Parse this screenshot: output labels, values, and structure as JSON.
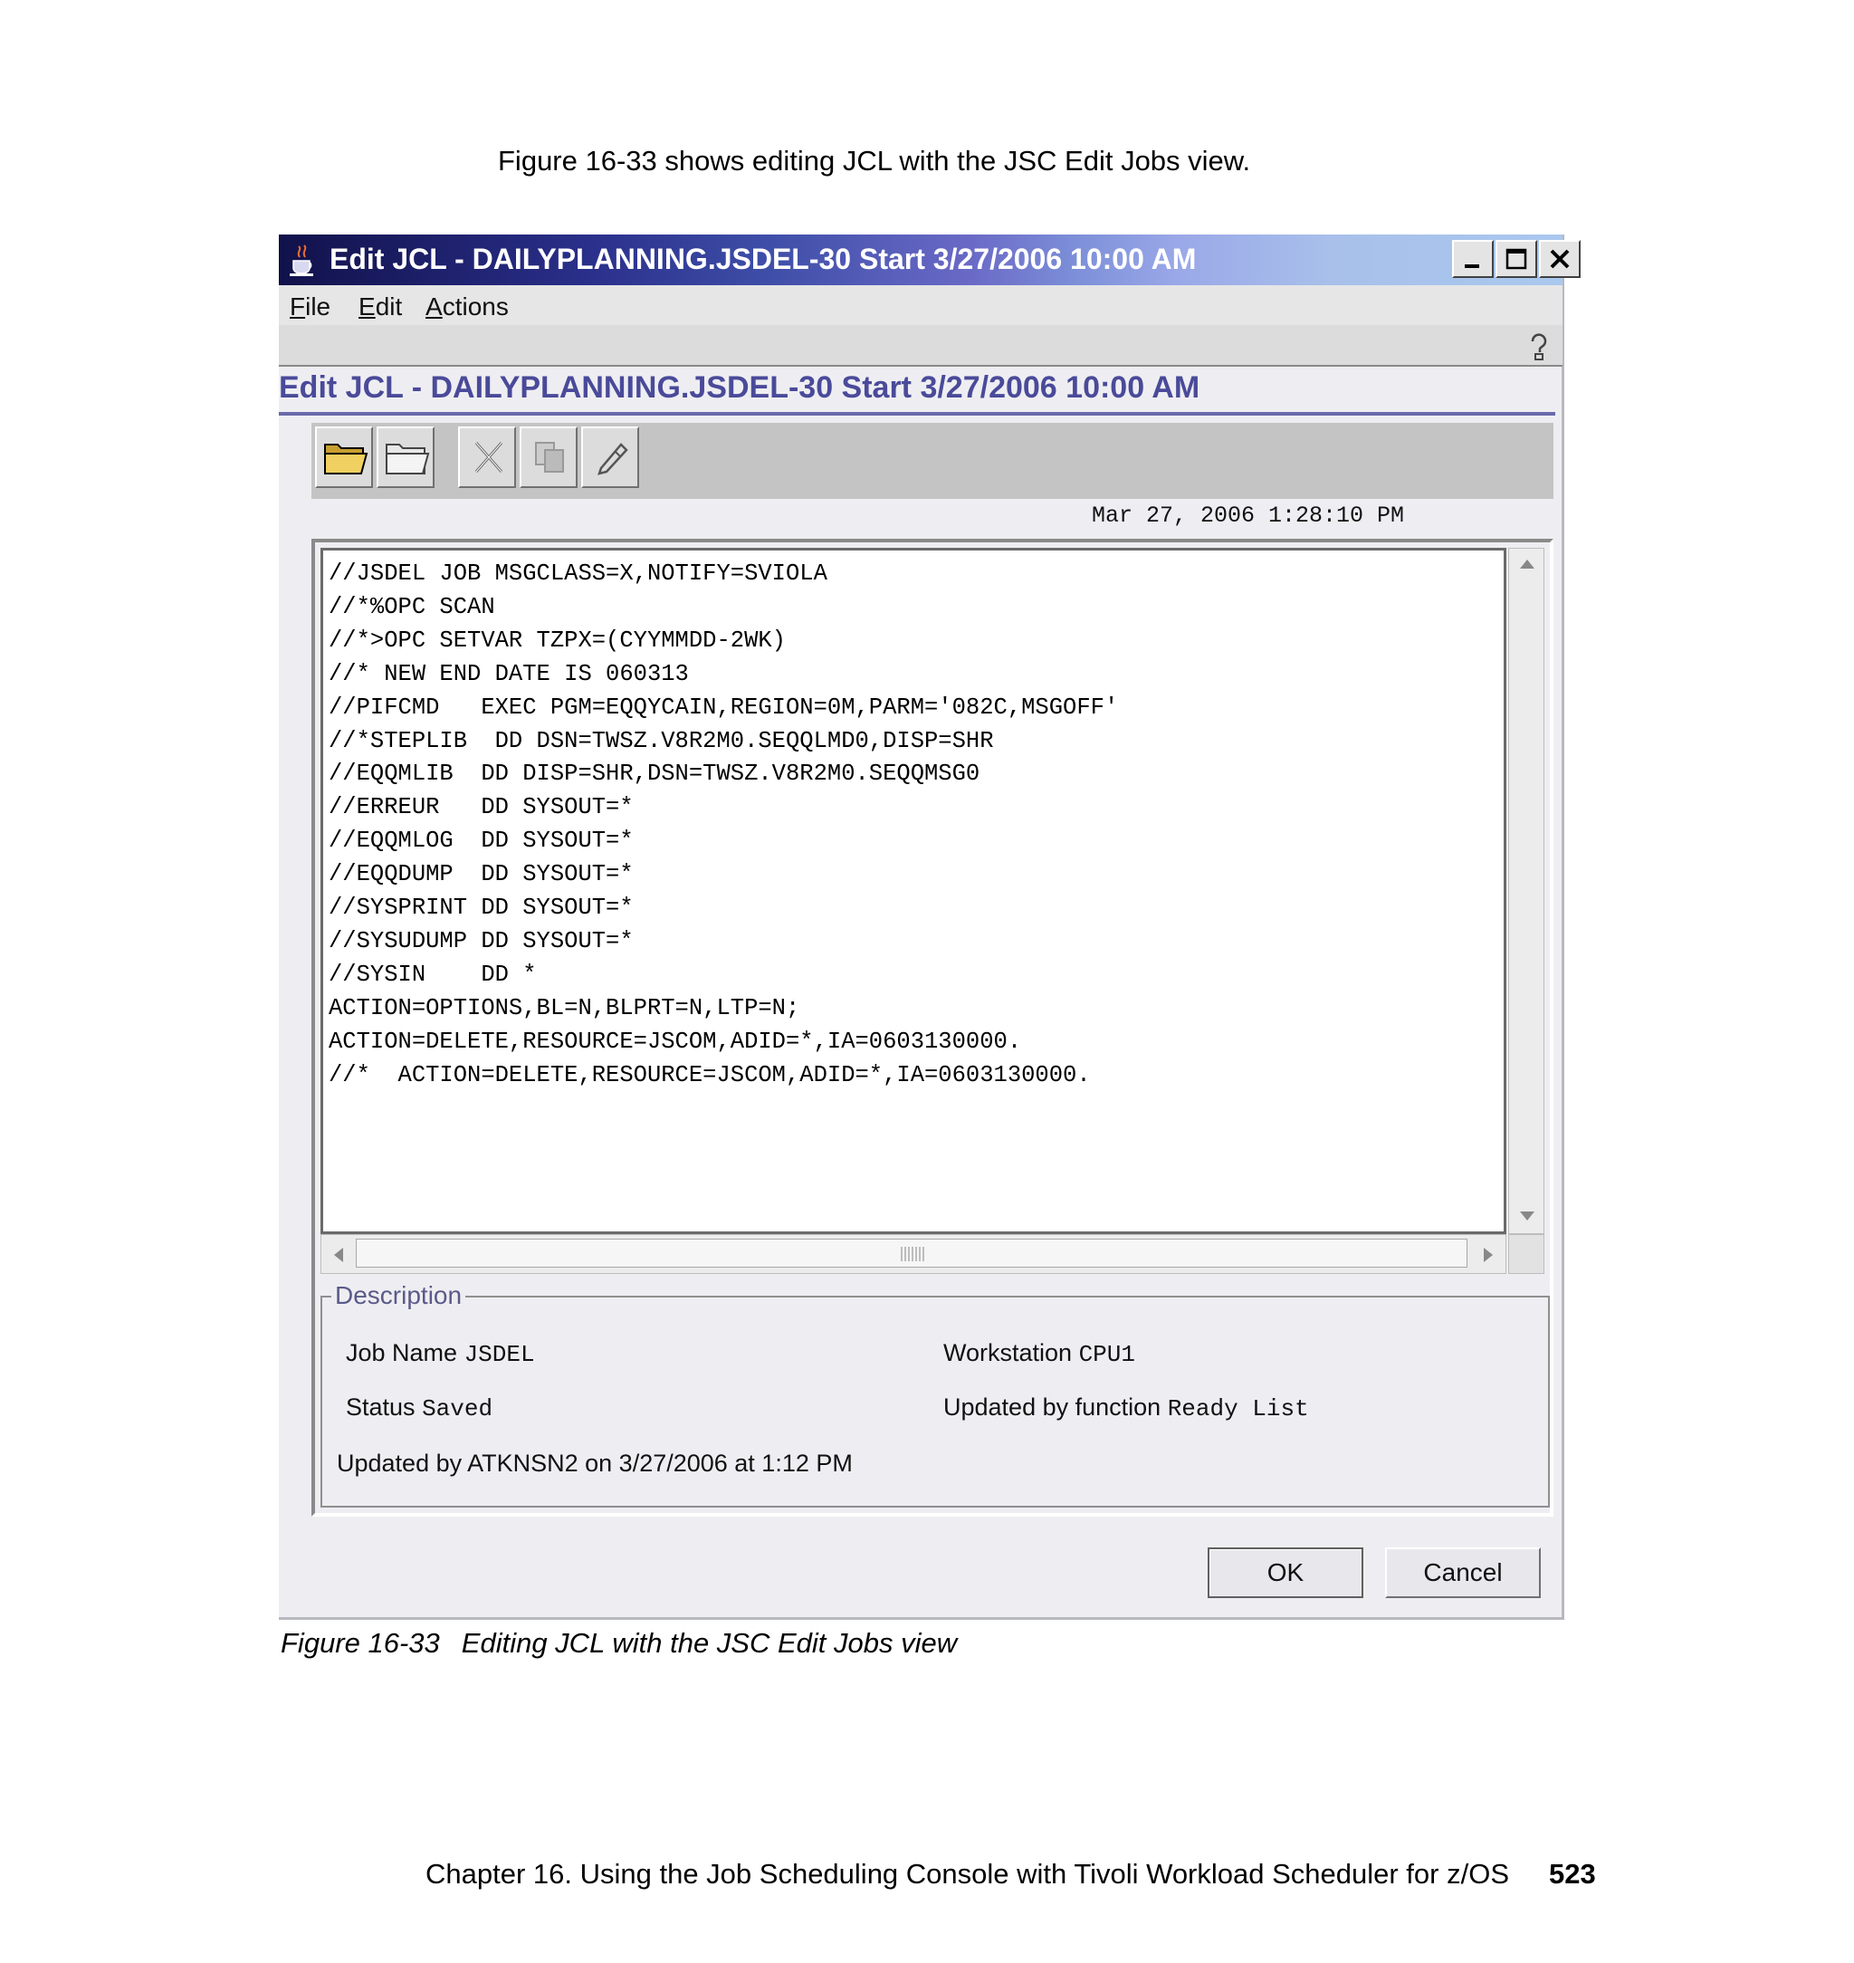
{
  "page": {
    "intro_text": "Figure 16-33 shows editing JCL with the JSC Edit Jobs view.",
    "caption_label": "Figure 16-33",
    "caption_text": "Editing JCL with the JSC Edit Jobs view",
    "footer_text": "Chapter 16. Using the Job Scheduling Console with Tivoli Workload Scheduler for z/OS",
    "page_number": "523"
  },
  "window": {
    "title": "Edit JCL - DAILYPLANNING.JSDEL-30 Start 3/27/2006 10:00 AM",
    "title_icon": "java-cup-icon",
    "controls": [
      "minimize-icon",
      "maximize-icon",
      "close-icon"
    ]
  },
  "menu": {
    "file": {
      "mnemonic": "F",
      "rest": "ile"
    },
    "edit": {
      "mnemonic": "E",
      "rest": "dit"
    },
    "actions": {
      "mnemonic": "A",
      "rest": "ctions"
    }
  },
  "panel": {
    "title": "Edit JCL - DAILYPLANNING.JSDEL-30 Start 3/27/2006 10:00 AM",
    "toolbar_icons": [
      "open-folder-icon",
      "folder-icon",
      "delete-icon",
      "copy-icon",
      "edit-icon"
    ],
    "timestamp": "Mar 27, 2006 1:28:10 PM"
  },
  "editor": {
    "lines": [
      "//JSDEL JOB MSGCLASS=X,NOTIFY=SVIOLA",
      "//*%OPC SCAN",
      "//*>OPC SETVAR TZPX=(CYYMMDD-2WK)",
      "//* NEW END DATE IS 060313",
      "//PIFCMD   EXEC PGM=EQQYCAIN,REGION=0M,PARM='082C,MSGOFF'",
      "//*STEPLIB  DD DSN=TWSZ.V8R2M0.SEQQLMD0,DISP=SHR",
      "//EQQMLIB  DD DISP=SHR,DSN=TWSZ.V8R2M0.SEQQMSG0",
      "//ERREUR   DD SYSOUT=*",
      "//EQQMLOG  DD SYSOUT=*",
      "//EQQDUMP  DD SYSOUT=*",
      "//SYSPRINT DD SYSOUT=*",
      "//SYSUDUMP DD SYSOUT=*",
      "//SYSIN    DD *",
      "ACTION=OPTIONS,BL=N,BLPRT=N,LTP=N;",
      "ACTION=DELETE,RESOURCE=JSCOM,ADID=*,IA=0603130000.",
      "//*  ACTION=DELETE,RESOURCE=JSCOM,ADID=*,IA=0603130000."
    ]
  },
  "description": {
    "legend": "Description",
    "job_name_label": "Job Name",
    "job_name_value": "JSDEL",
    "workstation_label": "Workstation",
    "workstation_value": "CPU1",
    "status_label": "Status",
    "status_value": "Saved",
    "updated_by_function_label": "Updated by function",
    "updated_by_function_value": "Ready List",
    "updated_by_text": "Updated by ATKNSN2 on 3/27/2006 at 1:12 PM"
  },
  "buttons": {
    "ok": "OK",
    "cancel": "Cancel"
  }
}
